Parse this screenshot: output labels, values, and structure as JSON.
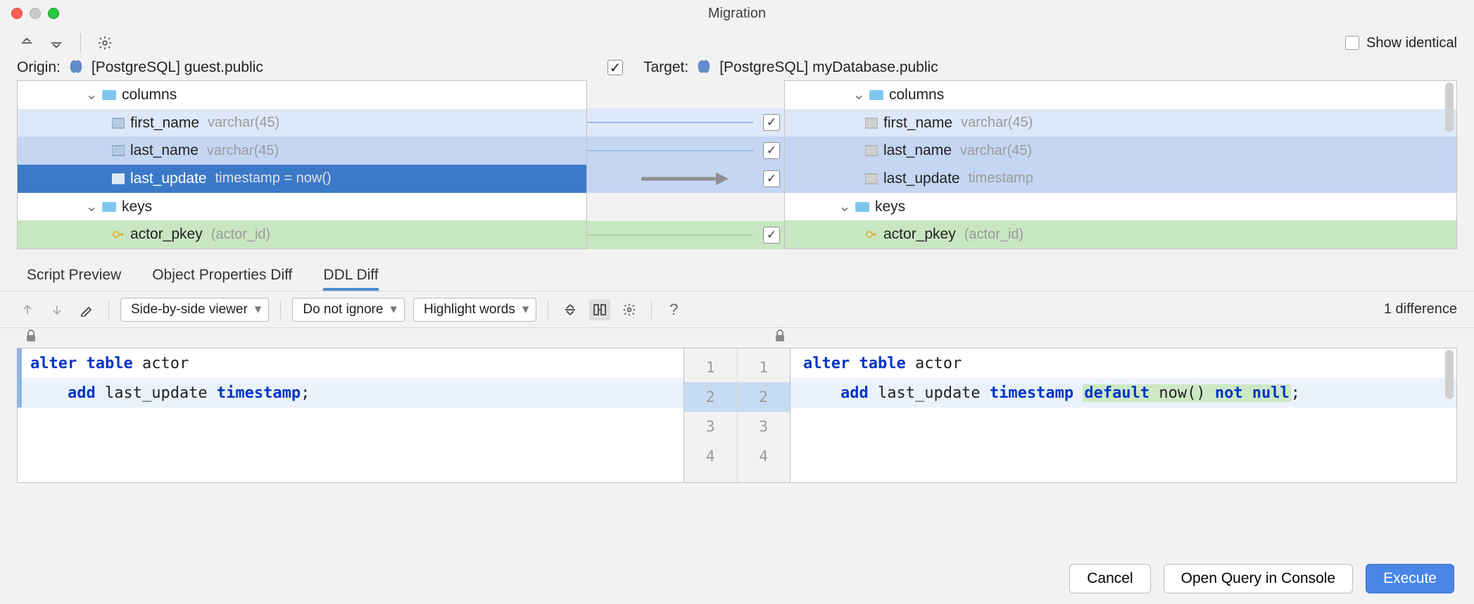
{
  "window": {
    "title": "Migration"
  },
  "top": {
    "show_identical_label": "Show identical",
    "show_identical_checked": false
  },
  "origin": {
    "prefix": "Origin:",
    "label": "[PostgreSQL] guest.public"
  },
  "target": {
    "prefix": "Target:",
    "label": "[PostgreSQL] myDatabase.public",
    "checked": true
  },
  "tree": {
    "columns_label": "columns",
    "keys_label": "keys",
    "left": [
      {
        "name": "first_name",
        "type": "varchar(45)"
      },
      {
        "name": "last_name",
        "type": "varchar(45)"
      },
      {
        "name": "last_update",
        "type": "timestamp = now()"
      }
    ],
    "right": [
      {
        "name": "first_name",
        "type": "varchar(45)"
      },
      {
        "name": "last_name",
        "type": "varchar(45)"
      },
      {
        "name": "last_update",
        "type": "timestamp"
      }
    ],
    "left_key": {
      "name": "actor_pkey",
      "cols": "(actor_id)"
    },
    "right_key": {
      "name": "actor_pkey",
      "cols": "(actor_id)"
    },
    "checks": [
      true,
      true,
      true,
      true
    ]
  },
  "tabs": {
    "script": "Script Preview",
    "props": "Object Properties Diff",
    "ddl": "DDL Diff",
    "active": "ddl"
  },
  "diffbar": {
    "viewer": "Side-by-side viewer",
    "ignore": "Do not ignore",
    "highlight": "Highlight words",
    "count": "1 difference"
  },
  "code": {
    "left": {
      "l1_kw1": "alter",
      "l1_kw2": "table",
      "l1_rest": " actor",
      "l2_kw": "add",
      "l2_name": " last_update ",
      "l2_type": "timestamp",
      "l2_end": ";"
    },
    "right": {
      "l1_kw1": "alter",
      "l1_kw2": "table",
      "l1_rest": " actor",
      "l2_kw": "add",
      "l2_name": " last_update ",
      "l2_type": "timestamp",
      "l2_diff": " default now() not null",
      "l2_diff_kw1": "default",
      "l2_diff_mid": " now() ",
      "l2_diff_kw2": "not null",
      "l2_end": ";"
    },
    "line_numbers": [
      "1",
      "2",
      "3",
      "4"
    ]
  },
  "footer": {
    "cancel": "Cancel",
    "console": "Open Query in Console",
    "execute": "Execute"
  }
}
